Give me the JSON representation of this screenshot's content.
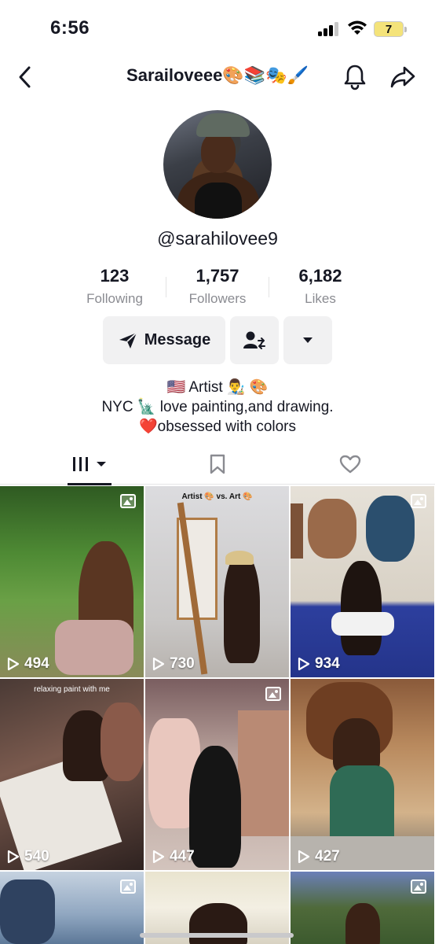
{
  "status_bar": {
    "time": "6:56",
    "battery_level": "7",
    "battery_color": "#f4e37a"
  },
  "nav": {
    "title": "Sarailoveee🎨📚🎭🖌️",
    "icons": [
      "back-arrow-icon",
      "bell-icon",
      "share-icon"
    ]
  },
  "profile": {
    "handle": "@sarahilovee9",
    "stats": [
      {
        "value": "123",
        "label": "Following"
      },
      {
        "value": "1,757",
        "label": "Followers"
      },
      {
        "value": "6,182",
        "label": "Likes"
      }
    ]
  },
  "actions": {
    "message_label": "Message"
  },
  "bio": {
    "lines": [
      "🇺🇸 Artist 👨‍🎨 🎨",
      "NYC 🗽 love painting,and drawing.",
      "❤️obsessed with colors"
    ]
  },
  "tabs": [
    "videos",
    "saved",
    "liked"
  ],
  "grid": {
    "items": [
      {
        "views": "494",
        "caption": "",
        "photo": true
      },
      {
        "views": "730",
        "caption": "Artist 🎨 vs. Art 🎨",
        "photo": false
      },
      {
        "views": "934",
        "caption": "",
        "photo": true
      },
      {
        "views": "540",
        "caption": "relaxing paint with me",
        "photo": false
      },
      {
        "views": "447",
        "caption": "",
        "photo": true
      },
      {
        "views": "427",
        "caption": "",
        "photo": false
      },
      {
        "views": "",
        "caption": "",
        "photo": true
      },
      {
        "views": "",
        "caption": "",
        "photo": false
      },
      {
        "views": "",
        "caption": "",
        "photo": true
      }
    ]
  },
  "colors": {
    "text_primary": "#161823",
    "text_secondary": "#8a8b91",
    "button_bg": "#f1f1f2"
  }
}
